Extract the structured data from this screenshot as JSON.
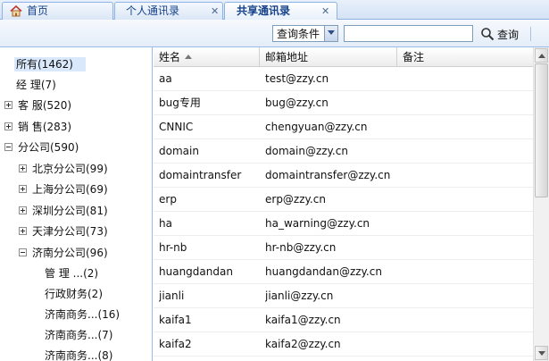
{
  "tabs": [
    {
      "label": "首页",
      "icon": "home-icon",
      "closable": false,
      "active": false
    },
    {
      "label": "个人通讯录",
      "closable": true,
      "active": false
    },
    {
      "label": "共享通讯录",
      "closable": true,
      "active": true
    }
  ],
  "toolbar": {
    "query_condition": "查询条件",
    "search_value": "",
    "query_label": "查询"
  },
  "tree": [
    {
      "label": "所有(1462)",
      "level": 0,
      "toggle": "none",
      "selected": true
    },
    {
      "label": "经 理(7)",
      "level": 0,
      "toggle": "none"
    },
    {
      "label": "客 服(520)",
      "level": 0,
      "toggle": "plus"
    },
    {
      "label": "销 售(283)",
      "level": 0,
      "toggle": "plus"
    },
    {
      "label": "分公司(590)",
      "level": 0,
      "toggle": "minus"
    },
    {
      "label": "北京分公司(99)",
      "level": 1,
      "toggle": "plus"
    },
    {
      "label": "上海分公司(69)",
      "level": 1,
      "toggle": "plus"
    },
    {
      "label": "深圳分公司(81)",
      "level": 1,
      "toggle": "plus"
    },
    {
      "label": "天津分公司(73)",
      "level": 1,
      "toggle": "plus"
    },
    {
      "label": "济南分公司(96)",
      "level": 1,
      "toggle": "minus"
    },
    {
      "label": "管 理 ...(2)",
      "level": 2,
      "toggle": "none"
    },
    {
      "label": "行政财务(2)",
      "level": 2,
      "toggle": "none"
    },
    {
      "label": "济南商务...(16)",
      "level": 2,
      "toggle": "none"
    },
    {
      "label": "济南商务...(7)",
      "level": 2,
      "toggle": "none"
    },
    {
      "label": "济南商务...(8)",
      "level": 2,
      "toggle": "none"
    }
  ],
  "grid": {
    "columns": [
      "姓名",
      "邮箱地址",
      "备注"
    ],
    "rows": [
      {
        "name": "aa",
        "email": "test@zzy.cn",
        "note": ""
      },
      {
        "name": "bug专用",
        "email": "bug@zzy.cn",
        "note": ""
      },
      {
        "name": "CNNIC",
        "email": "chengyuan@zzy.cn",
        "note": ""
      },
      {
        "name": "domain",
        "email": "domain@zzy.cn",
        "note": ""
      },
      {
        "name": "domaintransfer",
        "email": "domaintransfer@zzy.cn",
        "note": ""
      },
      {
        "name": "erp",
        "email": "erp@zzy.cn",
        "note": ""
      },
      {
        "name": "ha",
        "email": "ha_warning@zzy.cn",
        "note": ""
      },
      {
        "name": "hr-nb",
        "email": "hr-nb@zzy.cn",
        "note": ""
      },
      {
        "name": "huangdandan",
        "email": "huangdandan@zzy.cn",
        "note": ""
      },
      {
        "name": "jianli",
        "email": "jianli@zzy.cn",
        "note": ""
      },
      {
        "name": "kaifa1",
        "email": "kaifa1@zzy.cn",
        "note": ""
      },
      {
        "name": "kaifa2",
        "email": "kaifa2@zzy.cn",
        "note": ""
      }
    ]
  },
  "colors": {
    "accent": "#15428b",
    "border": "#99bbe8",
    "selection": "#d9e8fb"
  }
}
